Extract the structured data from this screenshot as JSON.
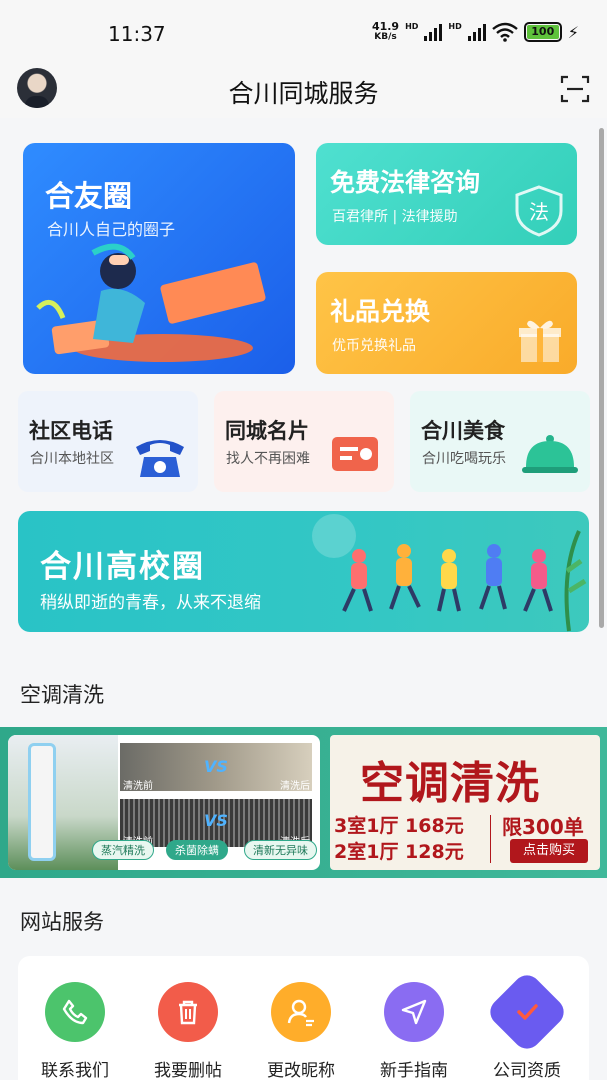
{
  "status_bar": {
    "time": "11:37",
    "net_speed": "41.9",
    "net_unit": "KB/s",
    "hd1": "HD",
    "hd2": "HD",
    "battery": "100"
  },
  "header": {
    "title": "合川同城服务"
  },
  "cards": {
    "friends": {
      "title": "合友圈",
      "subtitle": "合川人自己的圈子"
    },
    "law": {
      "title": "免费法律咨询",
      "subtitle": "百君律所 | 法律援助",
      "badge": "法"
    },
    "gift": {
      "title": "礼品兑换",
      "subtitle": "优币兑换礼品"
    },
    "community_phone": {
      "title": "社区电话",
      "subtitle": "合川本地社区"
    },
    "business_card": {
      "title": "同城名片",
      "subtitle": "找人不再困难"
    },
    "food": {
      "title": "合川美食",
      "subtitle": "合川吃喝玩乐"
    },
    "campus": {
      "title": "合川高校圈",
      "subtitle": "稍纵即逝的青春，从来不退缩"
    }
  },
  "sections": {
    "ac_title": "空调清洗",
    "service_title": "网站服务"
  },
  "ac_banner": {
    "headline": "空调清洗",
    "price1": "3室1厅  168元",
    "price2": "2室1厅  128元",
    "limit": "限300单",
    "buy": "点击购买",
    "before1": "清洗前",
    "after1": "清洗后",
    "before2": "清洗前",
    "after2": "清洗后",
    "vs": "VS",
    "pills": [
      "蒸汽精洗",
      "杀菌除螨",
      "清新无异味"
    ]
  },
  "services": [
    {
      "label": "联系我们",
      "color": "#4cc46c",
      "icon": "phone-icon"
    },
    {
      "label": "我要删帖",
      "color": "#f25c4a",
      "icon": "trash-icon"
    },
    {
      "label": "更改昵称",
      "color": "#ffad2a",
      "icon": "user-edit-icon"
    },
    {
      "label": "新手指南",
      "color": "#8a6cf2",
      "icon": "navigation-icon"
    },
    {
      "label": "公司资质",
      "color": "#6a5bf0",
      "icon": "certificate-icon"
    }
  ]
}
